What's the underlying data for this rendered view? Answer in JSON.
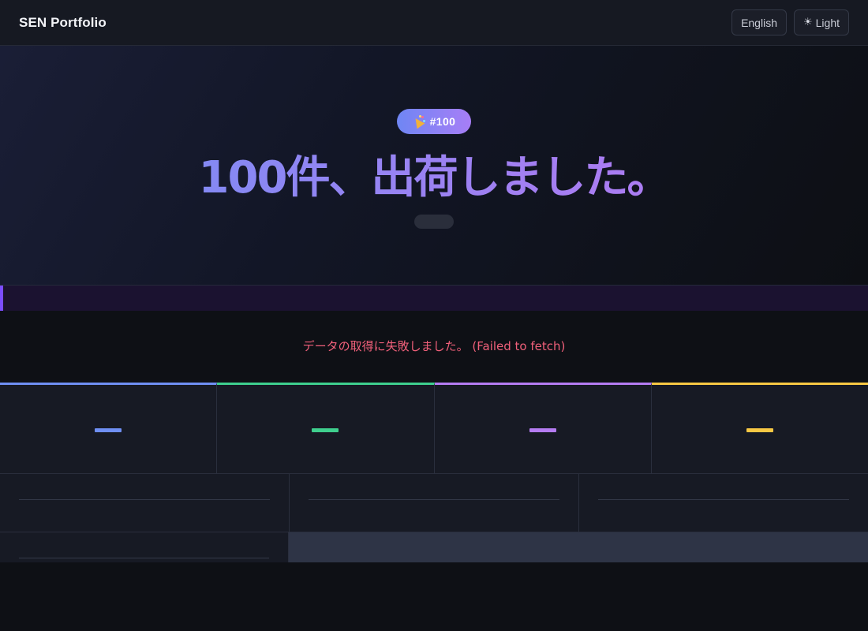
{
  "header": {
    "brand": "SEN Portfolio",
    "language_label": "English",
    "theme_icon": "sun-icon",
    "theme_label": "Light"
  },
  "hero": {
    "badge_icon": "party-popper-icon",
    "badge_label": "#100",
    "title": "100件、出荷しました。"
  },
  "error": {
    "message": "データの取得に失敗しました。 (Failed to fetch)"
  },
  "progress": {
    "fraction": 0.003
  },
  "stats": [
    {
      "color": "#6f8ff3"
    },
    {
      "color": "#3fcf8e"
    },
    {
      "color": "#b57cf2"
    },
    {
      "color": "#f7c844"
    }
  ],
  "colors": {
    "accent_purple": "#7c4dff",
    "error": "#f0607a",
    "background": "#0e1015"
  }
}
